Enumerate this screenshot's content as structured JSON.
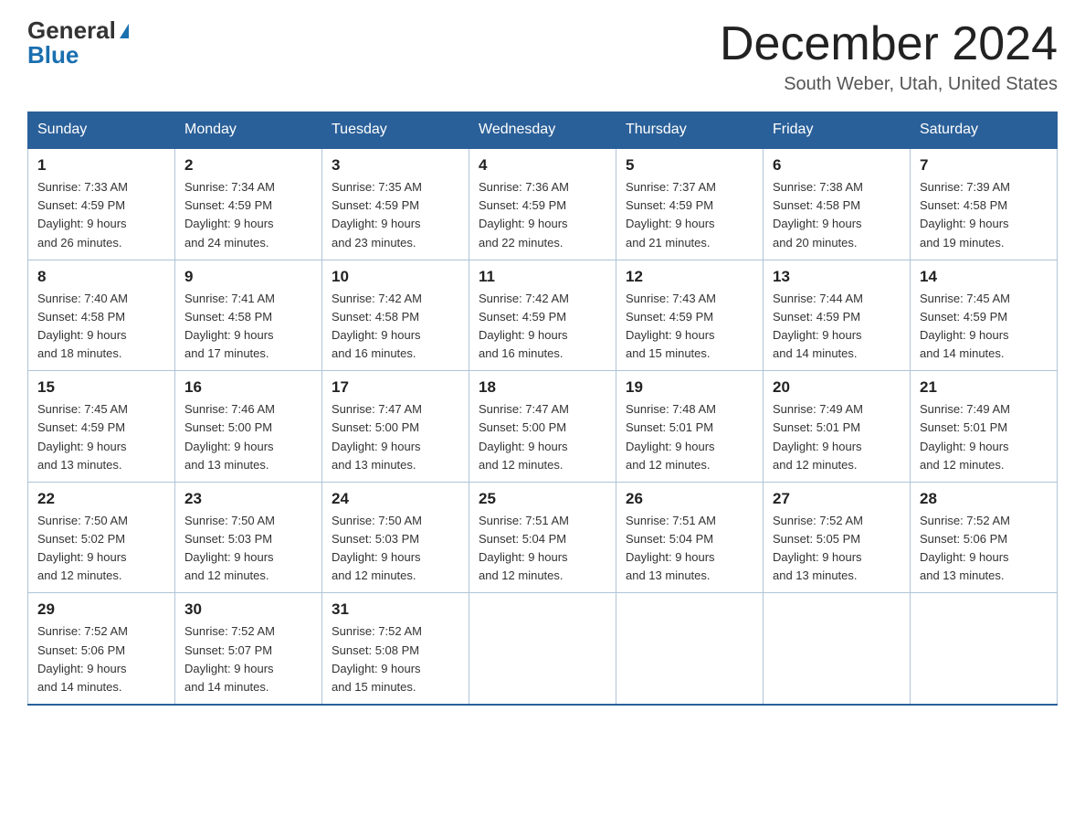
{
  "header": {
    "logo_general": "General",
    "logo_blue": "Blue",
    "month_title": "December 2024",
    "location": "South Weber, Utah, United States"
  },
  "weekdays": [
    "Sunday",
    "Monday",
    "Tuesday",
    "Wednesday",
    "Thursday",
    "Friday",
    "Saturday"
  ],
  "weeks": [
    [
      {
        "day": "1",
        "sunrise": "7:33 AM",
        "sunset": "4:59 PM",
        "daylight": "9 hours and 26 minutes."
      },
      {
        "day": "2",
        "sunrise": "7:34 AM",
        "sunset": "4:59 PM",
        "daylight": "9 hours and 24 minutes."
      },
      {
        "day": "3",
        "sunrise": "7:35 AM",
        "sunset": "4:59 PM",
        "daylight": "9 hours and 23 minutes."
      },
      {
        "day": "4",
        "sunrise": "7:36 AM",
        "sunset": "4:59 PM",
        "daylight": "9 hours and 22 minutes."
      },
      {
        "day": "5",
        "sunrise": "7:37 AM",
        "sunset": "4:59 PM",
        "daylight": "9 hours and 21 minutes."
      },
      {
        "day": "6",
        "sunrise": "7:38 AM",
        "sunset": "4:58 PM",
        "daylight": "9 hours and 20 minutes."
      },
      {
        "day": "7",
        "sunrise": "7:39 AM",
        "sunset": "4:58 PM",
        "daylight": "9 hours and 19 minutes."
      }
    ],
    [
      {
        "day": "8",
        "sunrise": "7:40 AM",
        "sunset": "4:58 PM",
        "daylight": "9 hours and 18 minutes."
      },
      {
        "day": "9",
        "sunrise": "7:41 AM",
        "sunset": "4:58 PM",
        "daylight": "9 hours and 17 minutes."
      },
      {
        "day": "10",
        "sunrise": "7:42 AM",
        "sunset": "4:58 PM",
        "daylight": "9 hours and 16 minutes."
      },
      {
        "day": "11",
        "sunrise": "7:42 AM",
        "sunset": "4:59 PM",
        "daylight": "9 hours and 16 minutes."
      },
      {
        "day": "12",
        "sunrise": "7:43 AM",
        "sunset": "4:59 PM",
        "daylight": "9 hours and 15 minutes."
      },
      {
        "day": "13",
        "sunrise": "7:44 AM",
        "sunset": "4:59 PM",
        "daylight": "9 hours and 14 minutes."
      },
      {
        "day": "14",
        "sunrise": "7:45 AM",
        "sunset": "4:59 PM",
        "daylight": "9 hours and 14 minutes."
      }
    ],
    [
      {
        "day": "15",
        "sunrise": "7:45 AM",
        "sunset": "4:59 PM",
        "daylight": "9 hours and 13 minutes."
      },
      {
        "day": "16",
        "sunrise": "7:46 AM",
        "sunset": "5:00 PM",
        "daylight": "9 hours and 13 minutes."
      },
      {
        "day": "17",
        "sunrise": "7:47 AM",
        "sunset": "5:00 PM",
        "daylight": "9 hours and 13 minutes."
      },
      {
        "day": "18",
        "sunrise": "7:47 AM",
        "sunset": "5:00 PM",
        "daylight": "9 hours and 12 minutes."
      },
      {
        "day": "19",
        "sunrise": "7:48 AM",
        "sunset": "5:01 PM",
        "daylight": "9 hours and 12 minutes."
      },
      {
        "day": "20",
        "sunrise": "7:49 AM",
        "sunset": "5:01 PM",
        "daylight": "9 hours and 12 minutes."
      },
      {
        "day": "21",
        "sunrise": "7:49 AM",
        "sunset": "5:01 PM",
        "daylight": "9 hours and 12 minutes."
      }
    ],
    [
      {
        "day": "22",
        "sunrise": "7:50 AM",
        "sunset": "5:02 PM",
        "daylight": "9 hours and 12 minutes."
      },
      {
        "day": "23",
        "sunrise": "7:50 AM",
        "sunset": "5:03 PM",
        "daylight": "9 hours and 12 minutes."
      },
      {
        "day": "24",
        "sunrise": "7:50 AM",
        "sunset": "5:03 PM",
        "daylight": "9 hours and 12 minutes."
      },
      {
        "day": "25",
        "sunrise": "7:51 AM",
        "sunset": "5:04 PM",
        "daylight": "9 hours and 12 minutes."
      },
      {
        "day": "26",
        "sunrise": "7:51 AM",
        "sunset": "5:04 PM",
        "daylight": "9 hours and 13 minutes."
      },
      {
        "day": "27",
        "sunrise": "7:52 AM",
        "sunset": "5:05 PM",
        "daylight": "9 hours and 13 minutes."
      },
      {
        "day": "28",
        "sunrise": "7:52 AM",
        "sunset": "5:06 PM",
        "daylight": "9 hours and 13 minutes."
      }
    ],
    [
      {
        "day": "29",
        "sunrise": "7:52 AM",
        "sunset": "5:06 PM",
        "daylight": "9 hours and 14 minutes."
      },
      {
        "day": "30",
        "sunrise": "7:52 AM",
        "sunset": "5:07 PM",
        "daylight": "9 hours and 14 minutes."
      },
      {
        "day": "31",
        "sunrise": "7:52 AM",
        "sunset": "5:08 PM",
        "daylight": "9 hours and 15 minutes."
      },
      null,
      null,
      null,
      null
    ]
  ],
  "labels": {
    "sunrise": "Sunrise:",
    "sunset": "Sunset:",
    "daylight": "Daylight:"
  }
}
